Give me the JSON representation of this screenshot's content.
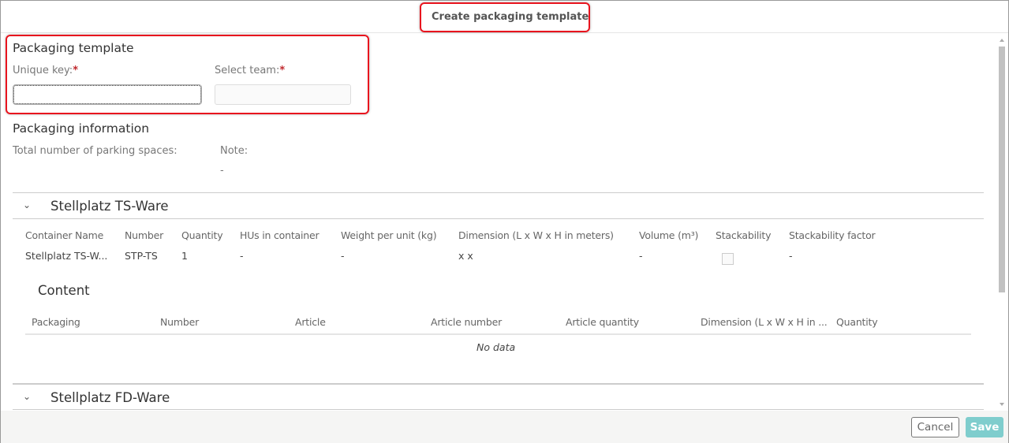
{
  "dialog": {
    "title": "Create packaging template"
  },
  "template": {
    "heading": "Packaging template",
    "unique_key_label": "Unique key:",
    "select_team_label": "Select team:",
    "required_mark": "*",
    "unique_key_value": "",
    "select_team_value": ""
  },
  "info": {
    "heading": "Packaging information",
    "total_label": "Total number of parking spaces:",
    "note_label": "Note:",
    "note_value": "-"
  },
  "sections": [
    {
      "title": "Stellplatz TS-Ware",
      "columns": [
        "Container Name",
        "Number",
        "Quantity",
        "HUs in container",
        "Weight per unit (kg)",
        "Dimension (L x W x H in meters)",
        "Volume (m³)",
        "Stackability",
        "Stackability factor"
      ],
      "row": {
        "name": "Stellplatz TS-W...",
        "number": "STP-TS",
        "quantity": "1",
        "hus": "-",
        "weight": "-",
        "dimension": "x x",
        "volume": "-",
        "stackable": false,
        "factor": "-"
      },
      "content": {
        "heading": "Content",
        "columns": [
          "Packaging",
          "Number",
          "Article",
          "Article number",
          "Article quantity",
          "Dimension (L x W x H in ...",
          "Quantity"
        ],
        "empty": "No data"
      }
    },
    {
      "title": "Stellplatz FD-Ware"
    }
  ],
  "footer": {
    "cancel": "Cancel",
    "save": "Save"
  },
  "colors": {
    "save": "#7fcdcd",
    "required": "#c0282d",
    "highlight": "#e8141e"
  }
}
